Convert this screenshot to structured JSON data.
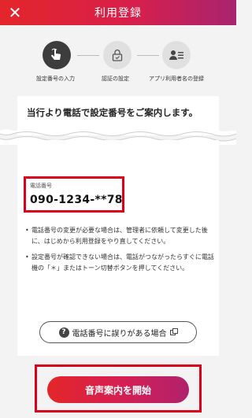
{
  "header": {
    "title": "利用登録",
    "close_icon": "close-icon"
  },
  "steps": [
    {
      "label": "設定番号の入力",
      "icon": "tap-hand-icon",
      "active": true
    },
    {
      "label": "認証の設定",
      "icon": "lock-icon",
      "active": false
    },
    {
      "label": "アプリ利用者名の登録",
      "icon": "user-list-icon",
      "active": false
    }
  ],
  "guidance": {
    "message": "当行より電話で設定番号をご案内します。"
  },
  "phone": {
    "label": "電話番号",
    "number": "090-1234-**78"
  },
  "notes": [
    "電話番号の変更が必要な場合は、管理者に依頼して変更した後に、はじめから利用登録をやり直してください。",
    "設定番号が確認できない場合は、電話がつながったらすぐに電話機の「＊」またはトーン切替ボタンを押してください。"
  ],
  "error_link": {
    "label": "電話番号に誤りがある場合"
  },
  "cta": {
    "label": "音声案内を開始"
  },
  "colors": {
    "brand_red": "#e3262a",
    "brand_magenta": "#b0226c",
    "highlight_red": "#d9001b"
  }
}
